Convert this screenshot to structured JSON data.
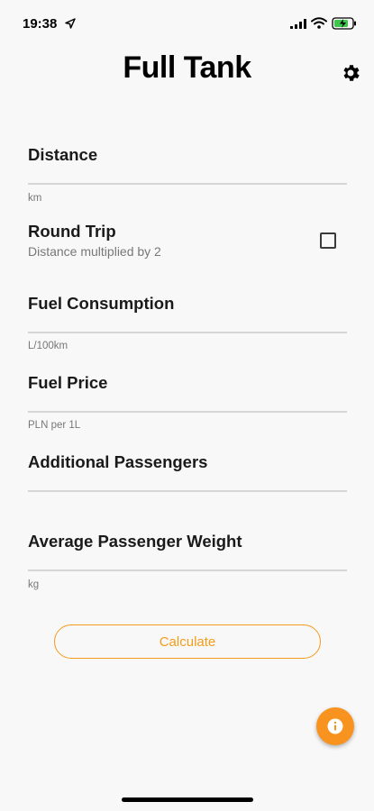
{
  "status_bar": {
    "time": "19:38"
  },
  "header": {
    "title": "Full Tank",
    "settings_icon": "gear-icon"
  },
  "form": {
    "distance": {
      "label": "Distance",
      "hint": "km"
    },
    "round_trip": {
      "label": "Round Trip",
      "subtitle": "Distance multiplied by 2",
      "checked": false
    },
    "fuel_consumption": {
      "label": "Fuel Consumption",
      "hint": "L/100km"
    },
    "fuel_price": {
      "label": "Fuel Price",
      "hint": "PLN per 1L"
    },
    "additional_passengers": {
      "label": "Additional Passengers"
    },
    "avg_passenger_weight": {
      "label": "Average Passenger Weight",
      "hint": "kg"
    }
  },
  "actions": {
    "calculate_label": "Calculate",
    "info_icon": "info-icon"
  },
  "colors": {
    "accent": "#f39c1c",
    "fab": "#f7931e",
    "background": "#f8f8f8"
  }
}
